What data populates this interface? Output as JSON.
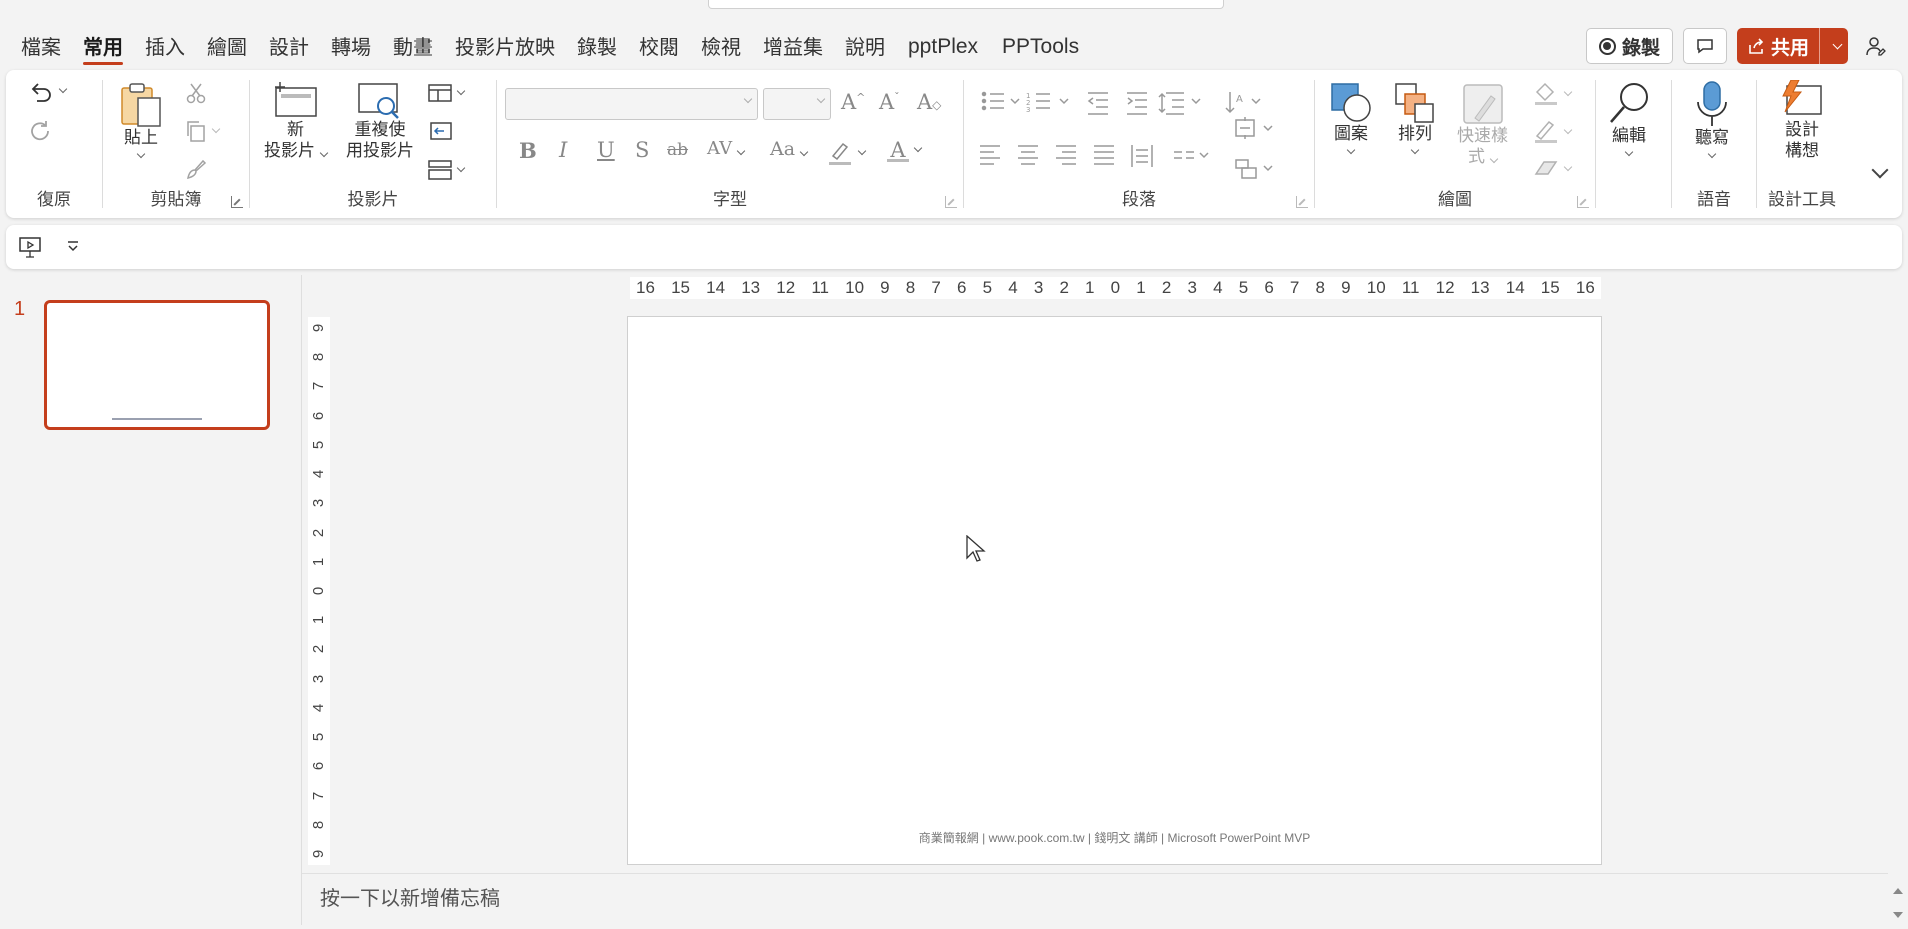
{
  "tabs": [
    "檔案",
    "常用",
    "插入",
    "繪圖",
    "設計",
    "轉場",
    "動畫",
    "投影片放映",
    "錄製",
    "校閱",
    "檢視",
    "增益集",
    "說明",
    "pptPlex",
    "PPTools"
  ],
  "active_tab": "常用",
  "topright": {
    "record_label": "錄製",
    "share_label": "共用"
  },
  "ribbon": {
    "undo_group": "復原",
    "clipboard": {
      "group": "剪貼簿",
      "paste": "貼上"
    },
    "slides": {
      "group": "投影片",
      "new_slide_line1": "新",
      "new_slide_line2": "投影片",
      "reuse_line1": "重複使",
      "reuse_line2": "用投影片"
    },
    "font": {
      "group": "字型",
      "bold": "B",
      "italic": "I",
      "underline": "U",
      "shadow": "S",
      "strike": "ab",
      "spacing": "AV",
      "case": "Aa",
      "fontcolor": "A"
    },
    "paragraph": {
      "group": "段落"
    },
    "drawing": {
      "group": "繪圖",
      "shapes": "圖案",
      "arrange": "排列",
      "quick_styles_line1": "快速樣",
      "quick_styles_line2": "式"
    },
    "editing": {
      "label": "編輯"
    },
    "voice": {
      "group": "語音",
      "dictate": "聽寫"
    },
    "designer": {
      "group": "設計工具",
      "line1": "設計",
      "line2": "構想"
    }
  },
  "thumbnails": [
    {
      "number": "1"
    }
  ],
  "hruler_ticks": [
    "16",
    "15",
    "14",
    "13",
    "12",
    "11",
    "10",
    "9",
    "8",
    "7",
    "6",
    "5",
    "4",
    "3",
    "2",
    "1",
    "0",
    "1",
    "2",
    "3",
    "4",
    "5",
    "6",
    "7",
    "8",
    "9",
    "10",
    "11",
    "12",
    "13",
    "14",
    "15",
    "16"
  ],
  "vruler_ticks": [
    "9",
    "8",
    "7",
    "6",
    "5",
    "4",
    "3",
    "2",
    "1",
    "0",
    "1",
    "2",
    "3",
    "4",
    "5",
    "6",
    "7",
    "8",
    "9"
  ],
  "slide": {
    "footer": "商業簡報網 | www.pook.com.tw | 錢明文 講師 | Microsoft PowerPoint MVP"
  },
  "notes_placeholder": "按一下以新增備忘稿",
  "colors": {
    "accent": "#c43e1c"
  }
}
